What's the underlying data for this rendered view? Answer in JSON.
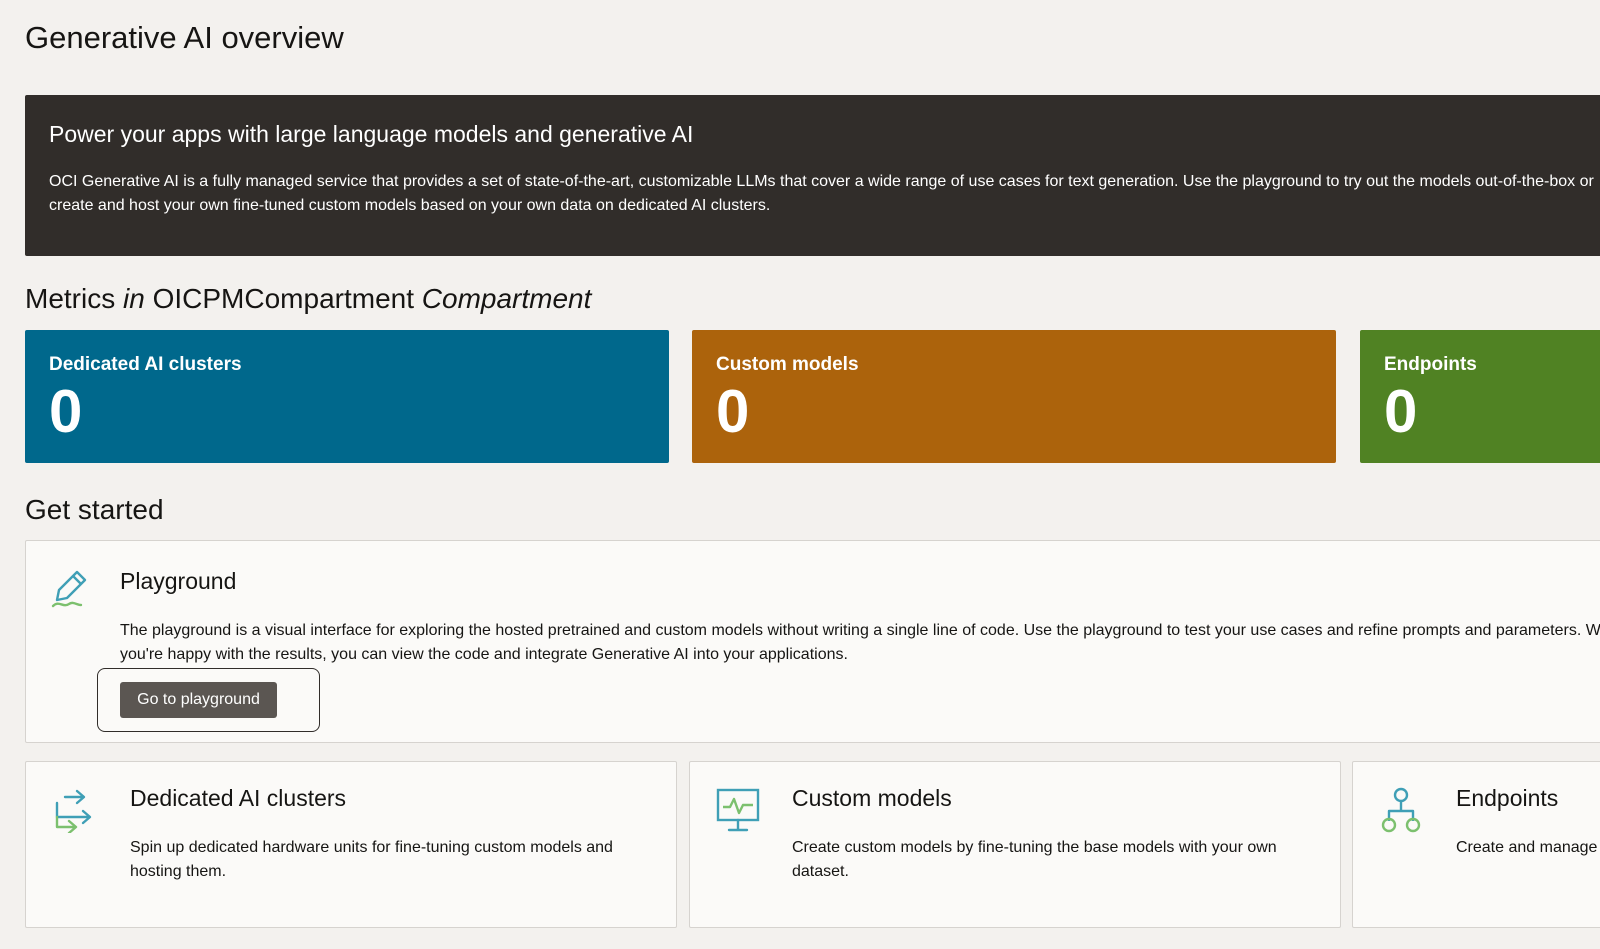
{
  "page": {
    "title": "Generative AI overview"
  },
  "banner": {
    "title": "Power your apps with large language models and generative AI",
    "description": "OCI Generative AI is a fully managed service that provides a set of state-of-the-art, customizable LLMs that cover a wide range of use cases for text generation. Use the playground to try out the models out-of-the-box or create and host your own fine-tuned custom models based on your own data on dedicated AI clusters."
  },
  "metrics": {
    "heading_prefix": "Metrics",
    "heading_in": "in",
    "heading_compartment": "OICPMCompartment",
    "heading_suffix": "Compartment",
    "cards": [
      {
        "label": "Dedicated AI clusters",
        "value": "0",
        "color": "#00688c"
      },
      {
        "label": "Custom models",
        "value": "0",
        "color": "#ac630c"
      },
      {
        "label": "Endpoints",
        "value": "0",
        "color": "#508223"
      }
    ]
  },
  "get_started": {
    "heading": "Get started",
    "playground": {
      "icon": "pencil-icon",
      "title": "Playground",
      "description": "The playground is a visual interface for exploring the hosted pretrained and custom models without writing a single line of code. Use the playground to test your use cases and refine prompts and parameters. When you're happy with the results, you can view the code and integrate Generative AI into your applications.",
      "button_label": "Go to playground"
    },
    "features": [
      {
        "icon": "transfer-arrows-icon",
        "title": "Dedicated AI clusters",
        "description": "Spin up dedicated hardware units for fine-tuning custom models and hosting them."
      },
      {
        "icon": "monitor-chart-icon",
        "title": "Custom models",
        "description": "Create custom models by fine-tuning the base models with your own dataset."
      },
      {
        "icon": "network-nodes-icon",
        "title": "Endpoints",
        "description": "Create and manage endpoints"
      }
    ]
  },
  "colors": {
    "banner_bg": "#312d2a",
    "icon_teal": "#3f9fb6",
    "icon_green": "#7cc06e"
  }
}
